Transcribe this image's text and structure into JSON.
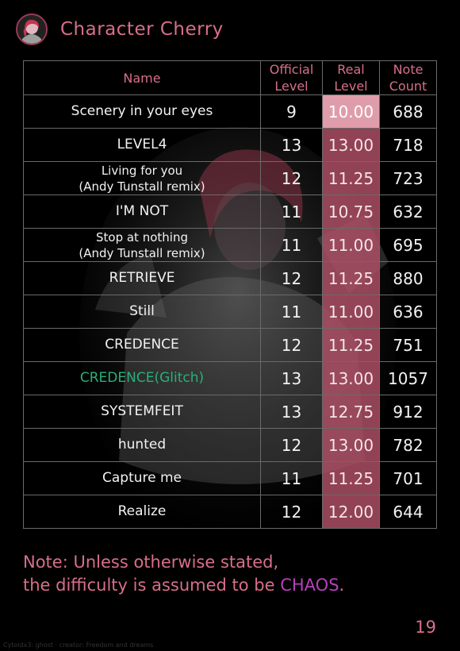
{
  "header": {
    "title": "Character Cherry"
  },
  "table": {
    "headers": {
      "name": "Name",
      "official_level_line1": "Official",
      "official_level_line2": "Level",
      "real_level_line1": "Real",
      "real_level_line2": "Level",
      "note_count_line1": "Note",
      "note_count_line2": "Count"
    },
    "rows": [
      {
        "name_line1": "Scenery in your eyes",
        "name_line2": "",
        "official": "9",
        "real": "10.00",
        "notes": "688"
      },
      {
        "name_line1": "LEVEL4",
        "name_line2": "",
        "official": "13",
        "real": "13.00",
        "notes": "718"
      },
      {
        "name_line1": "Living for you",
        "name_line2": "(Andy Tunstall remix)",
        "official": "12",
        "real": "11.25",
        "notes": "723"
      },
      {
        "name_line1": "I'M NOT",
        "name_line2": "",
        "official": "11",
        "real": "10.75",
        "notes": "632"
      },
      {
        "name_line1": "Stop at nothing",
        "name_line2": "(Andy Tunstall remix)",
        "official": "11",
        "real": "11.00",
        "notes": "695"
      },
      {
        "name_line1": "RETRIEVE",
        "name_line2": "",
        "official": "12",
        "real": "11.25",
        "notes": "880"
      },
      {
        "name_line1": "Still",
        "name_line2": "",
        "official": "11",
        "real": "11.00",
        "notes": "636"
      },
      {
        "name_line1": "CREDENCE",
        "name_line2": "",
        "official": "12",
        "real": "11.25",
        "notes": "751"
      },
      {
        "name_line1": "CREDENCE(Glitch)",
        "name_line2": "",
        "official": "13",
        "real": "13.00",
        "notes": "1057"
      },
      {
        "name_line1": "SYSTEMFEIT",
        "name_line2": "",
        "official": "13",
        "real": "12.75",
        "notes": "912"
      },
      {
        "name_line1": "hunted",
        "name_line2": "",
        "official": "12",
        "real": "13.00",
        "notes": "782"
      },
      {
        "name_line1": "Capture me",
        "name_line2": "",
        "official": "11",
        "real": "11.25",
        "notes": "701"
      },
      {
        "name_line1": "Realize",
        "name_line2": "",
        "official": "12",
        "real": "12.00",
        "notes": "644"
      }
    ]
  },
  "footnote": {
    "line1": "Note: Unless otherwise stated,",
    "line2_prefix": "the difficulty is assumed to be ",
    "line2_highlight": "CHAOS",
    "line2_suffix": "."
  },
  "page_number": "19",
  "credit": "Cytoidx3: ghost · creator: Freedom and dreams",
  "colors": {
    "accent": "#d76f89",
    "real_level_bg": "#b25068",
    "real_level_bg_light": "#f2aaba",
    "glitch_green": "#27b07a",
    "chaos_purple": "#b73fbb",
    "border": "#6a6a6a"
  },
  "icons": {
    "avatar": "character-portrait-icon"
  }
}
